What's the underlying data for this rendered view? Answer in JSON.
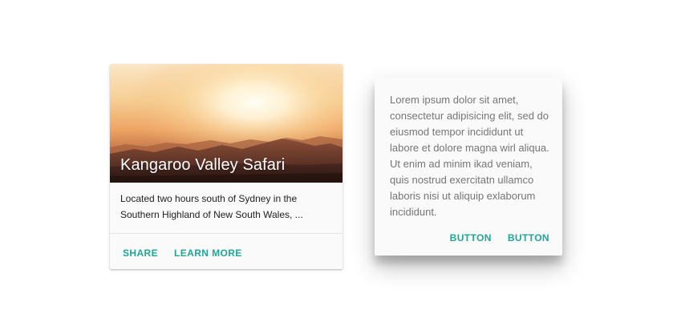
{
  "media_card": {
    "title": "Kangaroo Valley Safari",
    "supporting_text": "Located two hours south of Sydney in the Southern Highland of New South Wales, ...",
    "actions": {
      "share_label": "SHARE",
      "learn_more_label": "LEARN MORE"
    }
  },
  "text_card": {
    "body": "Lorem ipsum dolor sit amet, consectetur adipisicing elit, sed do eiusmod tempor incididunt ut labore et dolore magna wirl aliqua. Ut enim ad minim ikad veniam, quis nostrud exercitatn ullamco laboris nisi ut aliquip exlaborum incididunt.",
    "actions": {
      "button_1_label": "BUTTON",
      "button_2_label": "BUTTON"
    }
  },
  "colors": {
    "accent": "#21a696",
    "card_bg": "#fafafa",
    "body_text": "#757575",
    "title_text": "#ffffff"
  }
}
